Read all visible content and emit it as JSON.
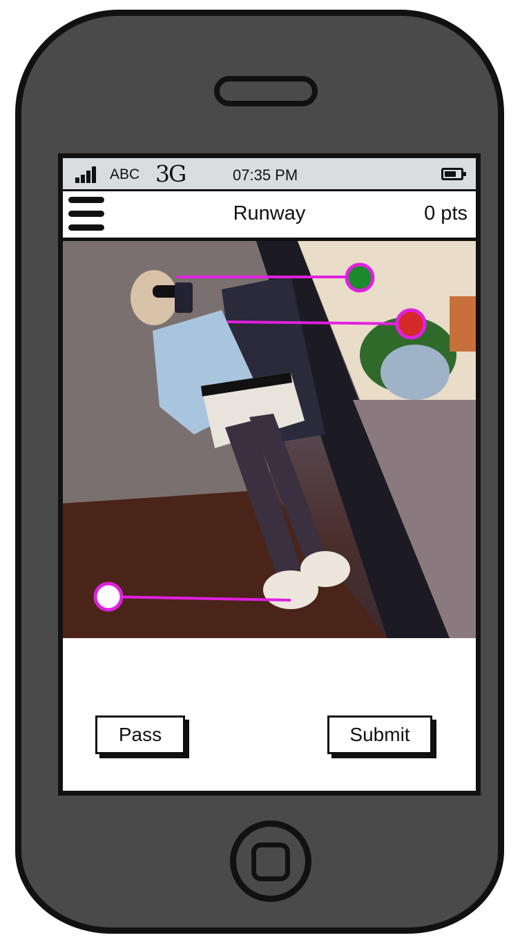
{
  "status_bar": {
    "carrier": "ABC",
    "network": "3G",
    "time": "07:35 PM",
    "signal_icon": "signal-bars-icon",
    "battery_icon": "battery-icon"
  },
  "header": {
    "title": "Runway",
    "points": "0 pts",
    "menu_icon": "hamburger-menu-icon"
  },
  "photo": {
    "description_icon": "fashion-photo",
    "markers": [
      {
        "color": "#1a8a2a",
        "label": "green"
      },
      {
        "color": "#d42a2a",
        "label": "red"
      },
      {
        "color": "#ffffff",
        "label": "white"
      }
    ],
    "marker_line_color": "#e020e0"
  },
  "actions": {
    "pass_label": "Pass",
    "submit_label": "Submit"
  }
}
